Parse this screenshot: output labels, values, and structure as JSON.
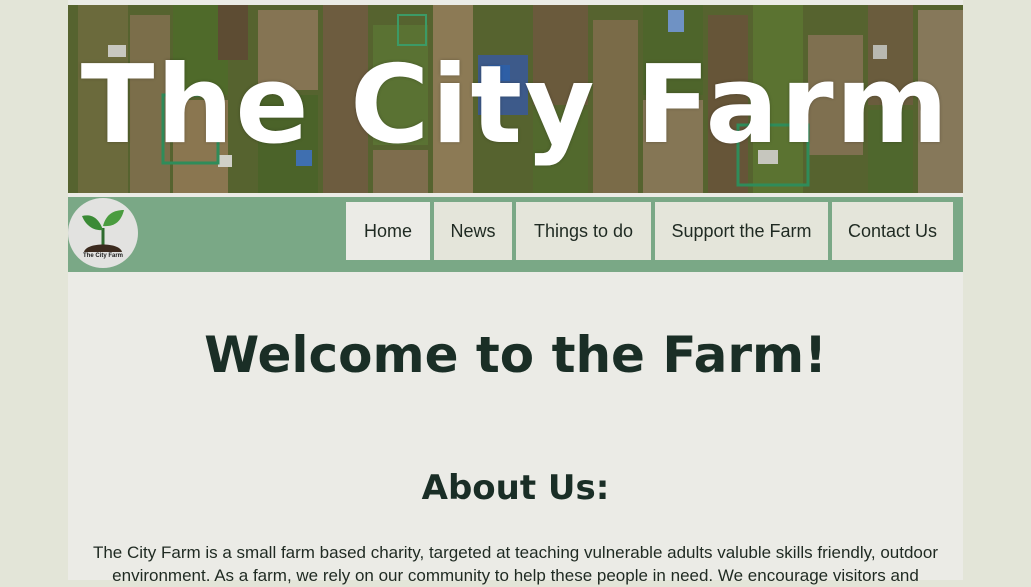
{
  "banner": {
    "title": "The City Farm"
  },
  "logo": {
    "text": "The City Farm"
  },
  "nav": {
    "items": [
      {
        "label": "Home",
        "active": true
      },
      {
        "label": "News",
        "active": false
      },
      {
        "label": "Things to do",
        "active": false
      },
      {
        "label": "Support the Farm",
        "active": false
      },
      {
        "label": "Contact Us",
        "active": false
      }
    ]
  },
  "main": {
    "heading": "Welcome to the Farm!",
    "about_heading": "About Us:",
    "about_text": "The City Farm is a small farm based charity, targeted at teaching vulnerable adults valuble skills friendly, outdoor environment. As a farm, we rely on our community to help these people in need. We encourage visitors and"
  },
  "colors": {
    "page_background": "#e3e5d8",
    "content_background": "#ebebe6",
    "navbar": "#7aa886",
    "nav_button": "#e4e5da",
    "heading_text": "#1a2e26"
  },
  "icons": {
    "logo": "seedling-icon"
  }
}
